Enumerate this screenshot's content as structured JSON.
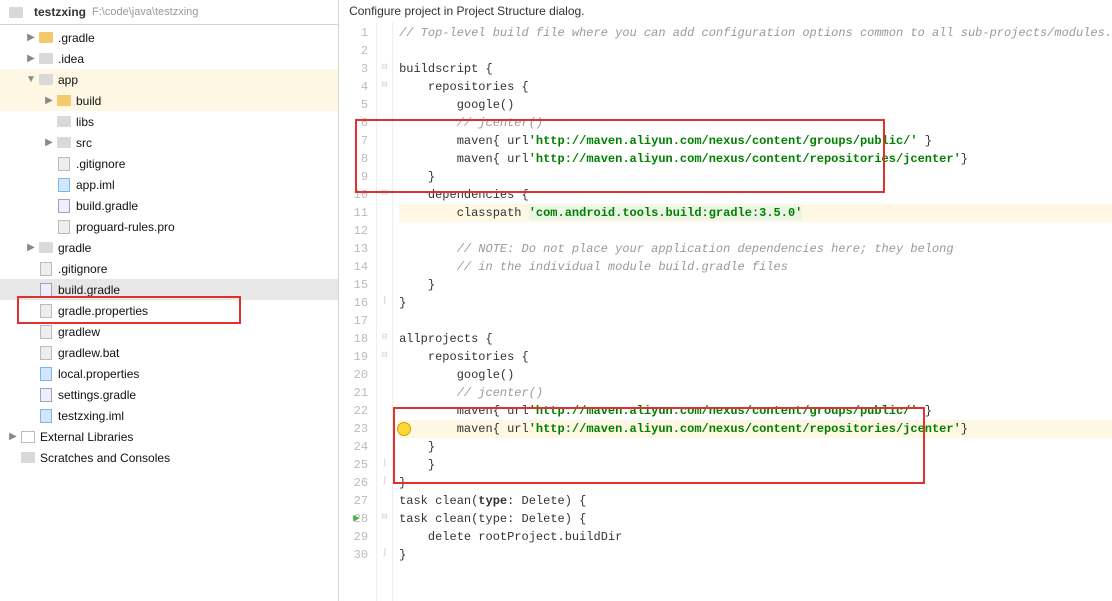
{
  "header": {
    "title": "testzxing",
    "path": "F:\\code\\java\\testzxing"
  },
  "tree": {
    "root": "testzxing",
    "items": [
      {
        "label": ".gradle",
        "indent": 1,
        "arrow": "right",
        "icon": "folder-y"
      },
      {
        "label": ".idea",
        "indent": 1,
        "arrow": "right",
        "icon": "folder-g"
      },
      {
        "label": "app",
        "indent": 1,
        "arrow": "down",
        "icon": "folder-g",
        "hl": true
      },
      {
        "label": "build",
        "indent": 2,
        "arrow": "right",
        "icon": "folder-y",
        "hl": true
      },
      {
        "label": "libs",
        "indent": 2,
        "arrow": "blank",
        "icon": "folder-g"
      },
      {
        "label": "src",
        "indent": 2,
        "arrow": "right",
        "icon": "folder-g"
      },
      {
        "label": ".gitignore",
        "indent": 2,
        "arrow": "blank",
        "icon": "file"
      },
      {
        "label": "app.iml",
        "indent": 2,
        "arrow": "blank",
        "icon": "file-blue"
      },
      {
        "label": "build.gradle",
        "indent": 2,
        "arrow": "blank",
        "icon": "gradle"
      },
      {
        "label": "proguard-rules.pro",
        "indent": 2,
        "arrow": "blank",
        "icon": "file"
      },
      {
        "label": "gradle",
        "indent": 1,
        "arrow": "right",
        "icon": "folder-g"
      },
      {
        "label": ".gitignore",
        "indent": 1,
        "arrow": "blank",
        "icon": "file"
      },
      {
        "label": "build.gradle",
        "indent": 1,
        "arrow": "blank",
        "icon": "gradle",
        "selected": true
      },
      {
        "label": "gradle.properties",
        "indent": 1,
        "arrow": "blank",
        "icon": "file"
      },
      {
        "label": "gradlew",
        "indent": 1,
        "arrow": "blank",
        "icon": "file"
      },
      {
        "label": "gradlew.bat",
        "indent": 1,
        "arrow": "blank",
        "icon": "file"
      },
      {
        "label": "local.properties",
        "indent": 1,
        "arrow": "blank",
        "icon": "file-blue"
      },
      {
        "label": "settings.gradle",
        "indent": 1,
        "arrow": "blank",
        "icon": "gradle"
      },
      {
        "label": "testzxing.iml",
        "indent": 1,
        "arrow": "blank",
        "icon": "file-blue"
      }
    ],
    "ext1": "External Libraries",
    "ext2": "Scratches and Consoles"
  },
  "banner": "Configure project in Project Structure dialog.",
  "code": {
    "l1": "// Top-level build file where you can add configuration options common to all sub-projects/modules.",
    "l3a": "buildscript {",
    "l4a": "repositories {",
    "l5a": "google()",
    "l6a": "// jcenter()",
    "l7a": "maven{ url",
    "l7b": "'http://maven.aliyun.com/nexus/content/groups/public/'",
    "l7c": " }",
    "l8a": "maven{ url",
    "l8b": "'http://maven.aliyun.com/nexus/content/repositories/jcenter'",
    "l8c": "}",
    "l9a": "}",
    "l10a": "dependencies {",
    "l11a": "classpath ",
    "l11b": "'com.android.tools.build:gradle:3.5.0'",
    "l13a": "// NOTE: Do not place your application dependencies here; they belong",
    "l14a": "// in the individual module build.gradle files",
    "l15a": "}",
    "l16a": "}",
    "l18a": "allprojects {",
    "l19a": "repositories {",
    "l20a": "google()",
    "l21a": "// jcenter()",
    "l22a": "maven{ url",
    "l22b": "'http://maven.aliyun.com/nexus/content/groups/public/'",
    "l22c": " }",
    "l23a": "maven{ url",
    "l23b": "'http://maven.aliyun.com/nexus/content/repositories/jcenter'",
    "l23c": "}",
    "l24a": "}",
    "l25a": "}",
    "l26a": "}",
    "l28a": "task clean(",
    "l28b": "type",
    "l28c": ": Delete) {",
    "l29a": "delete rootProject.buildDir",
    "l30a": "}"
  }
}
